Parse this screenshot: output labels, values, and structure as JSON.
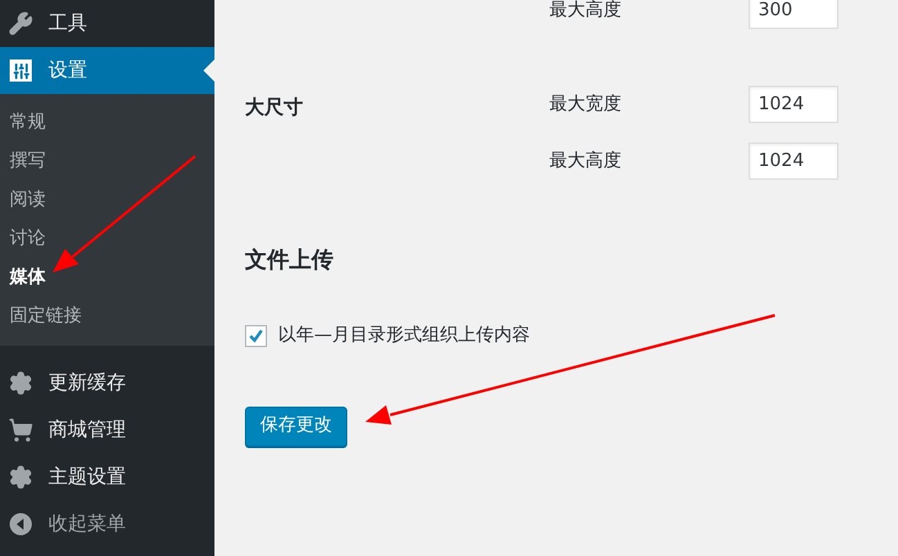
{
  "sidebar": {
    "items": [
      {
        "label": "工具",
        "selected": false
      },
      {
        "label": "设置",
        "selected": true,
        "children": [
          {
            "label": "常规",
            "selected": false
          },
          {
            "label": "撰写",
            "selected": false
          },
          {
            "label": "阅读",
            "selected": false
          },
          {
            "label": "讨论",
            "selected": false
          },
          {
            "label": "媒体",
            "selected": true
          },
          {
            "label": "固定链接",
            "selected": false
          }
        ]
      },
      {
        "label": "更新缓存",
        "selected": false
      },
      {
        "label": "商城管理",
        "selected": false
      },
      {
        "label": "主题设置",
        "selected": false
      },
      {
        "label": "收起菜单",
        "selected": false,
        "kind": "collapse"
      }
    ]
  },
  "media_sizes": [
    {
      "fields": [
        {
          "label": "最大高度",
          "value": "300"
        }
      ]
    },
    {
      "title": "大尺寸",
      "fields": [
        {
          "label": "最大宽度",
          "value": "1024"
        },
        {
          "label": "最大高度",
          "value": "1024"
        }
      ]
    }
  ],
  "file_upload": {
    "heading": "文件上传",
    "checkbox": {
      "label": "以年—月目录形式组织上传内容",
      "checked": true
    }
  },
  "save_button": "保存更改"
}
